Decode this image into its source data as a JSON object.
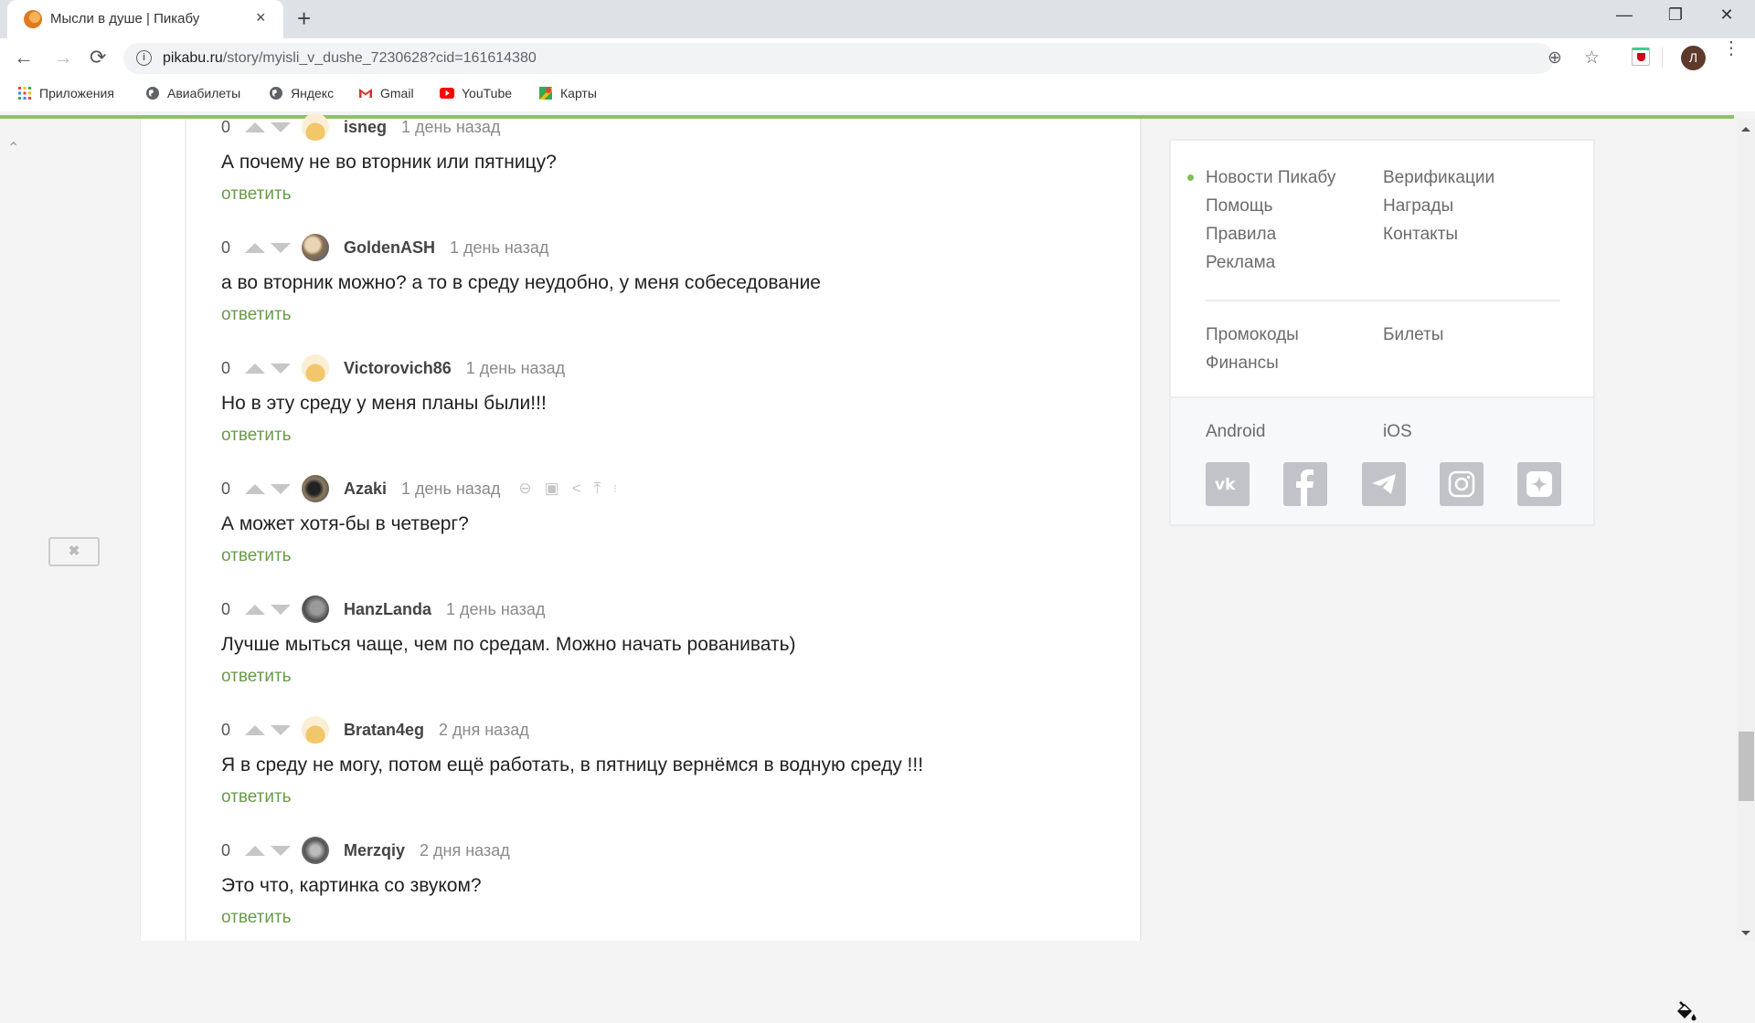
{
  "browser": {
    "tab_title": "Мысли в душе | Пикабу",
    "tab_close": "×",
    "new_tab": "+",
    "window_controls": {
      "minimize": "—",
      "restore": "❐",
      "close": "✕"
    },
    "nav": {
      "back": "←",
      "forward": "→",
      "reload": "⟳"
    },
    "url_host": "pikabu.ru",
    "url_path": "/story/myisli_v_dushe_7230628?cid=161614380",
    "info_icon": "i",
    "zoom_icon": "⊕",
    "star_icon": "☆",
    "profile_initial": "Л",
    "menu_icon": "⋮",
    "bookmarks": [
      {
        "label": "Приложения",
        "icon": "apps-grid-icon"
      },
      {
        "label": "Авиабилеты",
        "icon": "globe-icon"
      },
      {
        "label": "Яндекс",
        "icon": "globe-icon"
      },
      {
        "label": "Gmail",
        "icon": "gmail-icon"
      },
      {
        "label": "YouTube",
        "icon": "youtube-icon"
      },
      {
        "label": "Карты",
        "icon": "maps-icon"
      }
    ],
    "accent_color": "#8ec06c"
  },
  "left": {
    "up_chevron": "⌃",
    "close_ad": "✖"
  },
  "comments": [
    {
      "rating": "0",
      "user": "isneg",
      "time": "1 день назад",
      "text": "А почему не во вторник или пятницу?",
      "reply": "ответить",
      "avatar": "default"
    },
    {
      "rating": "0",
      "user": "GoldenASH",
      "time": "1 день назад",
      "text": "а во вторник можно? а то в среду неудобно, у меня собеседование",
      "reply": "ответить",
      "avatar": "photo"
    },
    {
      "rating": "0",
      "user": "Victorovich86",
      "time": "1 день назад",
      "text": "Но в эту среду у меня планы были!!!",
      "reply": "ответить",
      "avatar": "default"
    },
    {
      "rating": "0",
      "user": "Azaki",
      "time": "1 день назад",
      "text": "А может хотя-бы в четверг?",
      "reply": "ответить",
      "avatar": "photo",
      "actions": [
        "link-icon",
        "save-icon",
        "share-icon",
        "go-to-parent-icon",
        "more-icon"
      ]
    },
    {
      "rating": "0",
      "user": "HanzLanda",
      "time": "1 день назад",
      "text": "Лучше мыться чаще, чем по средам. Можно начать pованивать)",
      "reply": "ответить",
      "avatar": "photo"
    },
    {
      "rating": "0",
      "user": "Bratan4eg",
      "time": "2 дня назад",
      "text": "Я в среду не могу, потом ещё работать, в пятницу вернёмся в водную среду !!!",
      "reply": "ответить",
      "avatar": "default"
    },
    {
      "rating": "0",
      "user": "Merzqiy",
      "time": "2 дня назад",
      "text": "Это что, картинка со звуком?",
      "reply": "ответить",
      "avatar": "photo"
    }
  ],
  "sidebar": {
    "col1": [
      "Новости Пикабу",
      "Помощь",
      "Правила",
      "Реклама"
    ],
    "col2": [
      "Верификации",
      "Награды",
      "Контакты"
    ],
    "col3": [
      "Промокоды",
      "Финансы"
    ],
    "col4": [
      "Билеты"
    ],
    "apps": {
      "android": "Android",
      "ios": "iOS"
    },
    "social": [
      "vk",
      "facebook",
      "telegram",
      "instagram",
      "zen"
    ],
    "accent_dot_color": "#7cc153"
  }
}
